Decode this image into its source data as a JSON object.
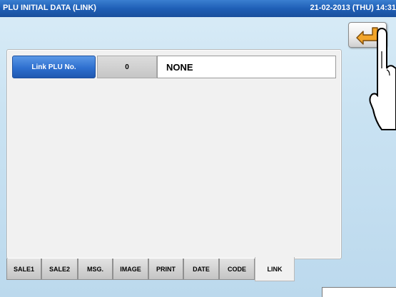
{
  "titlebar": {
    "title": "PLU INITIAL DATA (LINK)",
    "datetime": "21-02-2013 (THU)  14:31"
  },
  "back_button": {
    "icon": "return-arrow-icon"
  },
  "link_row": {
    "label": "Link PLU No.",
    "value": "0",
    "name": "NONE"
  },
  "tabs": [
    {
      "label": "SALE1"
    },
    {
      "label": "SALE2"
    },
    {
      "label": "MSG."
    },
    {
      "label": "IMAGE"
    },
    {
      "label": "PRINT"
    },
    {
      "label": "DATE"
    },
    {
      "label": "CODE"
    },
    {
      "label": "LINK",
      "active": true
    }
  ],
  "colors": {
    "titlebar": "#1f5fb6",
    "label_blue": "#2e6fcf",
    "screen_bg": "#c9e2f2",
    "arrow_orange": "#f2a52a"
  }
}
